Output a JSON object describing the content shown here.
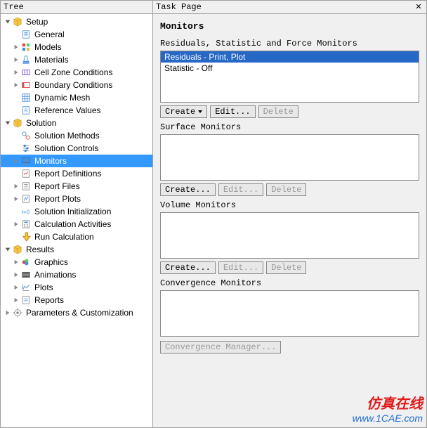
{
  "tree": {
    "title": "Tree",
    "nodes": [
      {
        "depth": 0,
        "exp": "open",
        "icon": "cube-yellow",
        "label": "Setup"
      },
      {
        "depth": 1,
        "exp": "none",
        "icon": "doc",
        "label": "General"
      },
      {
        "depth": 1,
        "exp": "closed",
        "icon": "models",
        "label": "Models"
      },
      {
        "depth": 1,
        "exp": "closed",
        "icon": "flask",
        "label": "Materials"
      },
      {
        "depth": 1,
        "exp": "closed",
        "icon": "cell",
        "label": "Cell Zone Conditions"
      },
      {
        "depth": 1,
        "exp": "closed",
        "icon": "boundary",
        "label": "Boundary Conditions"
      },
      {
        "depth": 1,
        "exp": "none",
        "icon": "dynmesh",
        "label": "Dynamic Mesh"
      },
      {
        "depth": 1,
        "exp": "none",
        "icon": "ref",
        "label": "Reference Values"
      },
      {
        "depth": 0,
        "exp": "open",
        "icon": "cube-yellow",
        "label": "Solution"
      },
      {
        "depth": 1,
        "exp": "none",
        "icon": "methods",
        "label": "Solution Methods"
      },
      {
        "depth": 1,
        "exp": "none",
        "icon": "controls",
        "label": "Solution Controls"
      },
      {
        "depth": 1,
        "exp": "closed",
        "icon": "monitor",
        "label": "Monitors",
        "selected": true
      },
      {
        "depth": 1,
        "exp": "none",
        "icon": "report-def",
        "label": "Report Definitions"
      },
      {
        "depth": 1,
        "exp": "closed",
        "icon": "report-file",
        "label": "Report Files"
      },
      {
        "depth": 1,
        "exp": "closed",
        "icon": "report-plot",
        "label": "Report Plots"
      },
      {
        "depth": 1,
        "exp": "none",
        "icon": "init",
        "label": "Solution Initialization"
      },
      {
        "depth": 1,
        "exp": "closed",
        "icon": "calc",
        "label": "Calculation Activities"
      },
      {
        "depth": 1,
        "exp": "none",
        "icon": "run",
        "label": "Run Calculation"
      },
      {
        "depth": 0,
        "exp": "open",
        "icon": "cube-yellow",
        "label": "Results"
      },
      {
        "depth": 1,
        "exp": "closed",
        "icon": "graphics",
        "label": "Graphics"
      },
      {
        "depth": 1,
        "exp": "closed",
        "icon": "anim",
        "label": "Animations"
      },
      {
        "depth": 1,
        "exp": "closed",
        "icon": "plots",
        "label": "Plots"
      },
      {
        "depth": 1,
        "exp": "closed",
        "icon": "reports",
        "label": "Reports"
      },
      {
        "depth": 0,
        "exp": "closed",
        "icon": "params",
        "label": "Parameters & Customization"
      }
    ]
  },
  "task": {
    "title": "Task Page",
    "heading": "Monitors",
    "section1_label": "Residuals, Statistic and Force Monitors",
    "section1_items": [
      {
        "text": "Residuals - Print, Plot",
        "selected": true
      },
      {
        "text": "Statistic - Off",
        "selected": false
      }
    ],
    "section2_label": "Surface Monitors",
    "section3_label": "Volume Monitors",
    "section4_label": "Convergence Monitors",
    "btn_create_dd": "Create",
    "btn_create": "Create...",
    "btn_edit": "Edit...",
    "btn_delete": "Delete",
    "btn_conv_mgr": "Convergence Manager..."
  },
  "watermark": {
    "cn": "仿真在线",
    "url": "www.1CAE.com"
  }
}
